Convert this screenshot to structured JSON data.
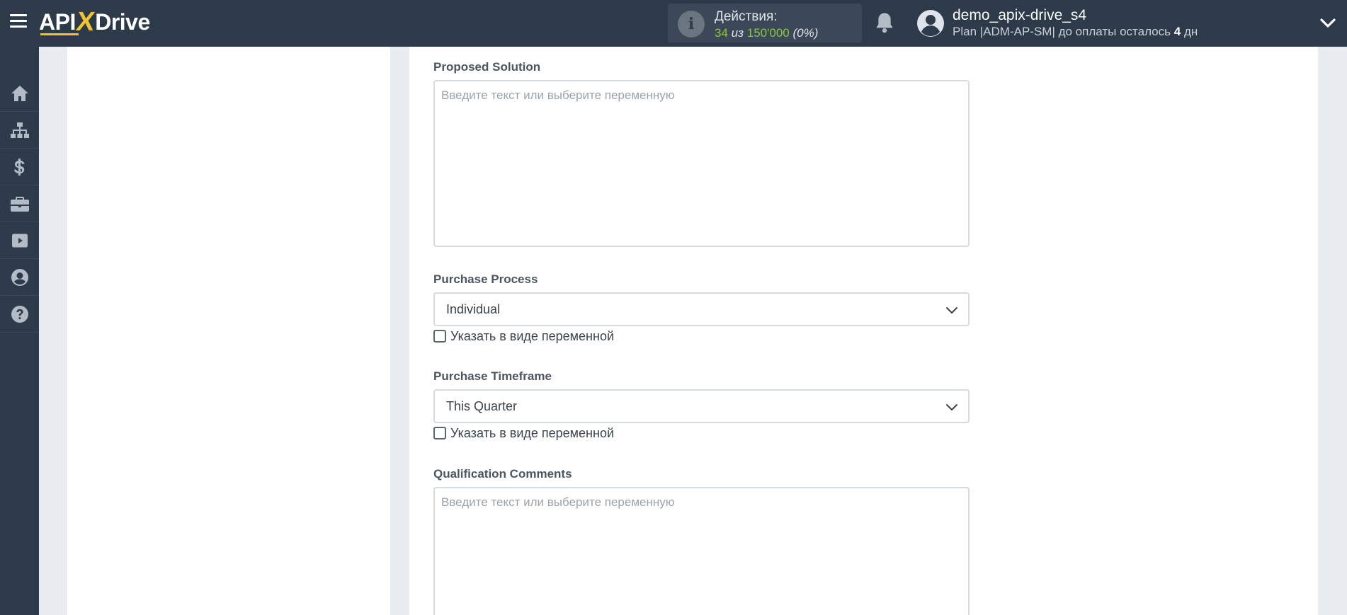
{
  "header": {
    "logo_text_api": "API",
    "logo_text_x": "X",
    "logo_text_drive": "Drive",
    "actions_label": "Действия:",
    "actions_used": "34",
    "actions_of": "из",
    "actions_total": "150'000",
    "actions_percent": "(0%)",
    "user_name": "demo_apix-drive_s4",
    "plan_prefix": "Plan |ADM-AP-SM| до оплаты осталось",
    "plan_days": "4",
    "plan_suffix": "дн"
  },
  "sidebar": {
    "items": [
      {
        "icon": "home-icon"
      },
      {
        "icon": "sitemap-icon"
      },
      {
        "icon": "dollar-icon"
      },
      {
        "icon": "briefcase-icon"
      },
      {
        "icon": "youtube-icon"
      },
      {
        "icon": "user-circle-icon"
      },
      {
        "icon": "help-icon"
      }
    ]
  },
  "form": {
    "proposed_solution": {
      "label": "Proposed Solution",
      "placeholder": "Введите текст или выберите переменную"
    },
    "purchase_process": {
      "label": "Purchase Process",
      "value": "Individual",
      "checkbox_label": "Указать в виде переменной"
    },
    "purchase_timeframe": {
      "label": "Purchase Timeframe",
      "value": "This Quarter",
      "checkbox_label": "Указать в виде переменной"
    },
    "qualification_comments": {
      "label": "Qualification Comments",
      "placeholder": "Введите текст или выберите переменную"
    }
  },
  "colors": {
    "topbar": "#2d3a4a",
    "accent_yellow": "#f2c230",
    "accent_green": "#8cc63e",
    "page_bg": "#e9edf2"
  }
}
